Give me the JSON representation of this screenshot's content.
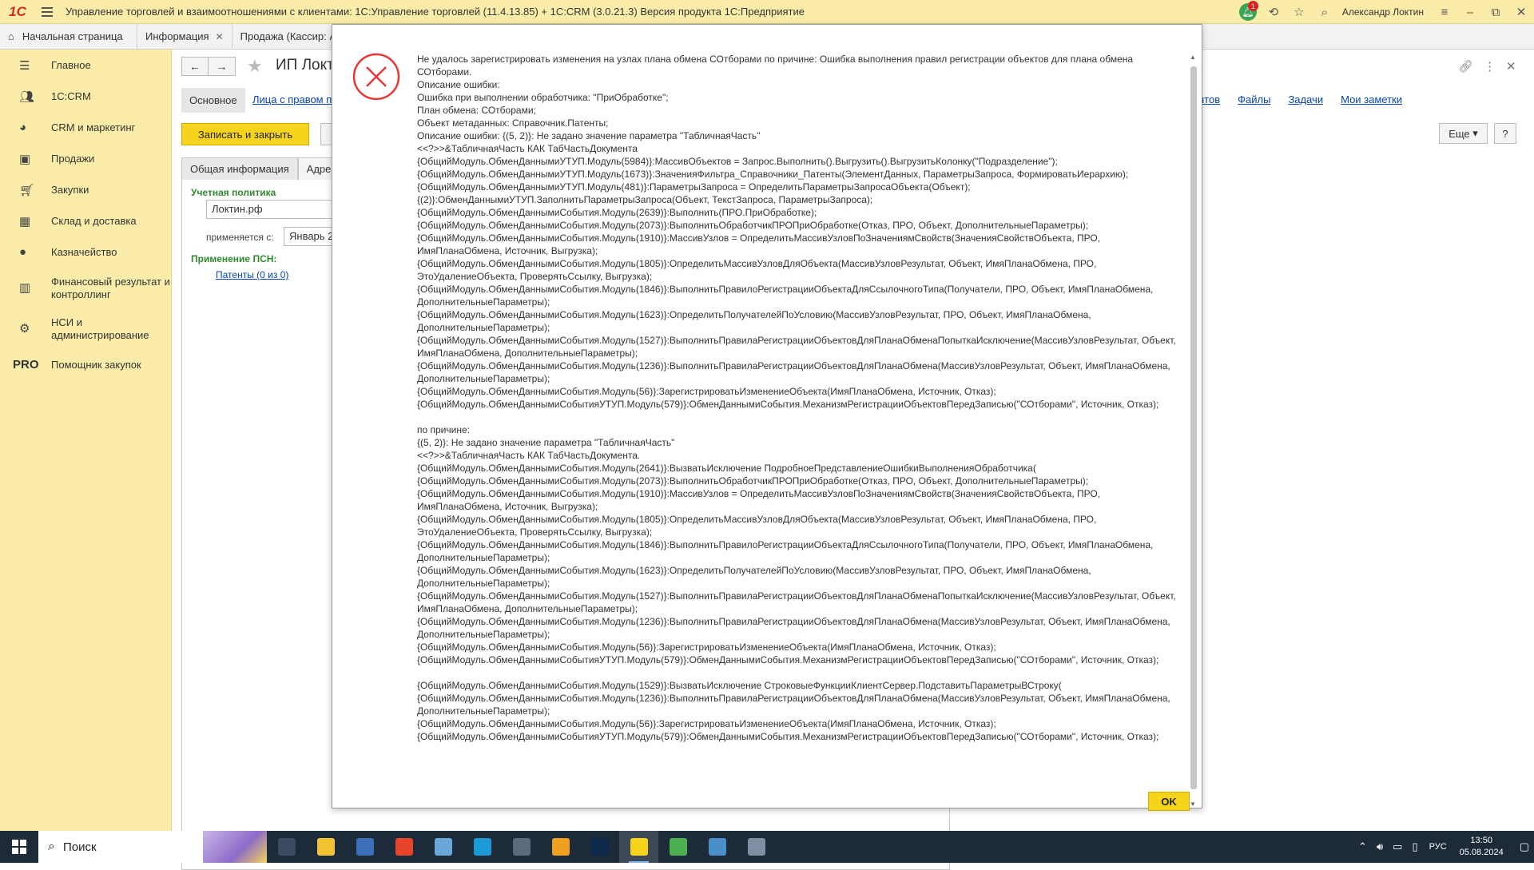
{
  "titlebar": {
    "logo": "1С",
    "title": "Управление торговлей и взаимоотношениями с клиентами: 1С:Управление торговлей (11.4.13.85) + 1С:CRM (3.0.21.3) Версия продукта 1С:Предприятие",
    "notification_count": "1",
    "user": "Александр Локтин"
  },
  "tabs": [
    {
      "label": "Начальная страница"
    },
    {
      "label": "Информация"
    },
    {
      "label": "Продажа (Кассир: А"
    }
  ],
  "sidebar": {
    "items": [
      {
        "label": "Главное",
        "icon": "menu-lines-icon"
      },
      {
        "label": "1С:CRM",
        "icon": "people-icon"
      },
      {
        "label": "CRM и маркетинг",
        "icon": "pie-icon"
      },
      {
        "label": "Продажи",
        "icon": "bag-icon"
      },
      {
        "label": "Закупки",
        "icon": "cart-icon"
      },
      {
        "label": "Склад и доставка",
        "icon": "grid-icon"
      },
      {
        "label": "Казначейство",
        "icon": "coin-icon"
      },
      {
        "label": "Финансовый результат и контроллинг",
        "icon": "chart-icon"
      },
      {
        "label": "НСИ и администрирование",
        "icon": "gear-icon"
      },
      {
        "label": "Помощник закупок",
        "icon": "PRO"
      }
    ]
  },
  "form": {
    "title": "ИП Локт",
    "section_basic": "Основное",
    "section_link": "Лица с правом п",
    "links": [
      "нтов",
      "Файлы",
      "Задачи",
      "Мои заметки"
    ],
    "save_close": "Записать и закрыть",
    "more": "Еще",
    "help": "?",
    "subtabs": [
      "Общая информация",
      "Адрес"
    ],
    "policy_label": "Учетная политика",
    "policy_value": "Локтин.рф",
    "applies_label": "применяется с:",
    "applies_value": "Январь 2",
    "psn_label": "Применение ПСН:",
    "patents_link": "Патенты (0 из 0)"
  },
  "dialog": {
    "message": "Не удалось зарегистрировать изменения на узлах плана обмена СОтборами по причине: Ошибка выполнения правил регистрации объектов для плана обмена СОтборами.\nОписание ошибки:\nОшибка при выполнении обработчика: \"ПриОбработке\";\nПлан обмена: СОтборами;\nОбъект метаданных: Справочник.Патенты;\nОписание ошибки: {(5, 2)}: Не задано значение параметра \"ТабличнаяЧасть\"\n<<?>>&ТабличнаяЧасть КАК ТабЧастьДокумента\n{ОбщийМодуль.ОбменДаннымиУТУП.Модуль(5984)}:МассивОбъектов = Запрос.Выполнить().Выгрузить().ВыгрузитьКолонку(\"Подразделение\");\n{ОбщийМодуль.ОбменДаннымиУТУП.Модуль(1673)}:ЗначенияФильтра_Справочники_Патенты(ЭлементДанных, ПараметрыЗапроса, ФормироватьИерархию);\n{ОбщийМодуль.ОбменДаннымиУТУП.Модуль(481)}:ПараметрыЗапроса = ОпределитьПараметрыЗапросаОбъекта(Объект);\n{(2)}:ОбменДаннымиУТУП.ЗаполнитьПараметрыЗапроса(Объект, ТекстЗапроса, ПараметрыЗапроса);\n{ОбщийМодуль.ОбменДаннымиСобытия.Модуль(2639)}:Выполнить(ПРО.ПриОбработке);\n{ОбщийМодуль.ОбменДаннымиСобытия.Модуль(2073)}:ВыполнитьОбработчикПРОПриОбработке(Отказ, ПРО, Объект, ДополнительныеПараметры);\n{ОбщийМодуль.ОбменДаннымиСобытия.Модуль(1910)}:МассивУзлов = ОпределитьМассивУзловПоЗначениямСвойств(ЗначенияСвойствОбъекта, ПРО, ИмяПланаОбмена, Источник, Выгрузка);\n{ОбщийМодуль.ОбменДаннымиСобытия.Модуль(1805)}:ОпределитьМассивУзловДляОбъекта(МассивУзловРезультат, Объект, ИмяПланаОбмена, ПРО, ЭтоУдалениеОбъекта, ПроверятьСсылку, Выгрузка);\n{ОбщийМодуль.ОбменДаннымиСобытия.Модуль(1846)}:ВыполнитьПравилоРегистрацииОбъектаДляСсылочногоТипа(Получатели, ПРО, Объект, ИмяПланаОбмена, ДополнительныеПараметры);\n{ОбщийМодуль.ОбменДаннымиСобытия.Модуль(1623)}:ОпределитьПолучателейПоУсловию(МассивУзловРезультат, ПРО, Объект, ИмяПланаОбмена, ДополнительныеПараметры);\n{ОбщийМодуль.ОбменДаннымиСобытия.Модуль(1527)}:ВыполнитьПравилаРегистрацииОбъектовДляПланаОбменаПопыткаИсключение(МассивУзловРезультат, Объект, ИмяПланаОбмена, ДополнительныеПараметры);\n{ОбщийМодуль.ОбменДаннымиСобытия.Модуль(1236)}:ВыполнитьПравилаРегистрацииОбъектовДляПланаОбмена(МассивУзловРезультат, Объект, ИмяПланаОбмена, ДополнительныеПараметры);\n{ОбщийМодуль.ОбменДаннымиСобытия.Модуль(56)}:ЗарегистрироватьИзменениеОбъекта(ИмяПланаОбмена, Источник, Отказ);\n{ОбщийМодуль.ОбменДаннымиСобытияУТУП.Модуль(579)}:ОбменДаннымиСобытия.МеханизмРегистрацииОбъектовПередЗаписью(\"СОтборами\", Источник, Отказ);\n\nпо причине:\n{(5, 2)}: Не задано значение параметра \"ТабличнаяЧасть\"\n<<?>>&ТабличнаяЧасть КАК ТабЧастьДокумента.\n{ОбщийМодуль.ОбменДаннымиСобытия.Модуль(2641)}:ВызватьИсключение ПодробноеПредставлениеОшибкиВыполненияОбработчика(\n{ОбщийМодуль.ОбменДаннымиСобытия.Модуль(2073)}:ВыполнитьОбработчикПРОПриОбработке(Отказ, ПРО, Объект, ДополнительныеПараметры);\n{ОбщийМодуль.ОбменДаннымиСобытия.Модуль(1910)}:МассивУзлов = ОпределитьМассивУзловПоЗначениямСвойств(ЗначенияСвойствОбъекта, ПРО, ИмяПланаОбмена, Источник, Выгрузка);\n{ОбщийМодуль.ОбменДаннымиСобытия.Модуль(1805)}:ОпределитьМассивУзловДляОбъекта(МассивУзловРезультат, Объект, ИмяПланаОбмена, ПРО, ЭтоУдалениеОбъекта, ПроверятьСсылку, Выгрузка);\n{ОбщийМодуль.ОбменДаннымиСобытия.Модуль(1846)}:ВыполнитьПравилоРегистрацииОбъектаДляСсылочногоТипа(Получатели, ПРО, Объект, ИмяПланаОбмена, ДополнительныеПараметры);\n{ОбщийМодуль.ОбменДаннымиСобытия.Модуль(1623)}:ОпределитьПолучателейПоУсловию(МассивУзловРезультат, ПРО, Объект, ИмяПланаОбмена, ДополнительныеПараметры);\n{ОбщийМодуль.ОбменДаннымиСобытия.Модуль(1527)}:ВыполнитьПравилаРегистрацииОбъектовДляПланаОбменаПопыткаИсключение(МассивУзловРезультат, Объект, ИмяПланаОбмена, ДополнительныеПараметры);\n{ОбщийМодуль.ОбменДаннымиСобытия.Модуль(1236)}:ВыполнитьПравилаРегистрацииОбъектовДляПланаОбмена(МассивУзловРезультат, Объект, ИмяПланаОбмена, ДополнительныеПараметры);\n{ОбщийМодуль.ОбменДаннымиСобытия.Модуль(56)}:ЗарегистрироватьИзменениеОбъекта(ИмяПланаОбмена, Источник, Отказ);\n{ОбщийМодуль.ОбменДаннымиСобытияУТУП.Модуль(579)}:ОбменДаннымиСобытия.МеханизмРегистрацииОбъектовПередЗаписью(\"СОтборами\", Источник, Отказ);\n\n{ОбщийМодуль.ОбменДаннымиСобытия.Модуль(1529)}:ВызватьИсключение СтроковыеФункцииКлиентСервер.ПодставитьПараметрыВСтроку(\n{ОбщийМодуль.ОбменДаннымиСобытия.Модуль(1236)}:ВыполнитьПравилаРегистрацииОбъектовДляПланаОбмена(МассивУзловРезультат, Объект, ИмяПланаОбмена, ДополнительныеПараметры);\n{ОбщийМодуль.ОбменДаннымиСобытия.Модуль(56)}:ЗарегистрироватьИзменениеОбъекта(ИмяПланаОбмена, Источник, Отказ);\n{ОбщийМодуль.ОбменДаннымиСобытияУТУП.Модуль(579)}:ОбменДаннымиСобытия.МеханизмРегистрацииОбъектовПередЗаписью(\"СОтборами\", Источник, Отказ);",
    "ok_label": "OK"
  },
  "taskbar": {
    "search_placeholder": "Поиск",
    "lang": "РУС",
    "time": "13:50",
    "date": "05.08.2024",
    "apps": [
      {
        "icon": "task-view-icon",
        "color": "#3b4a5e"
      },
      {
        "icon": "explorer-icon",
        "color": "#f1c232"
      },
      {
        "icon": "save-app-icon",
        "color": "#3b6fb8"
      },
      {
        "icon": "yandex-icon",
        "color": "#e8432b"
      },
      {
        "icon": "notes-app-icon",
        "color": "#6aa7d8"
      },
      {
        "icon": "edge-icon",
        "color": "#1b9ad6"
      },
      {
        "icon": "calculator-icon",
        "color": "#5a6b7d"
      },
      {
        "icon": "chrome-canary-icon",
        "color": "#f0a020"
      },
      {
        "icon": "photoshop-icon",
        "color": "#0d2a4a"
      },
      {
        "icon": "onec-icon",
        "color": "#f7d41c"
      },
      {
        "icon": "chrome-icon",
        "color": "#4caf50"
      },
      {
        "icon": "monitor-app-icon",
        "color": "#4a90c8"
      },
      {
        "icon": "remote-desktop-icon",
        "color": "#7f8fa3"
      }
    ]
  }
}
